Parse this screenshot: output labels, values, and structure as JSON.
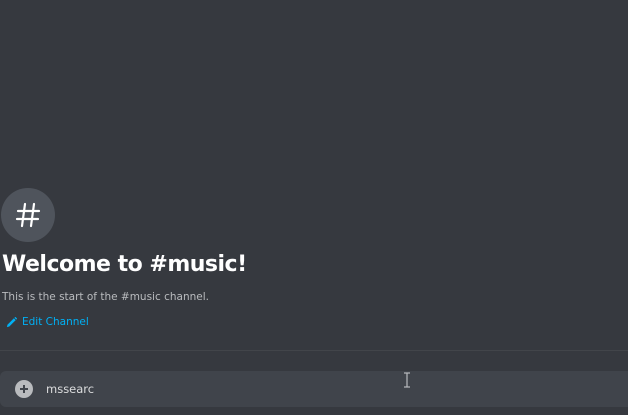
{
  "channel": {
    "welcome_title": "Welcome to #music!",
    "welcome_description": "This is the start of the #music channel.",
    "edit_label": "Edit Channel",
    "hash_icon": "hash-icon",
    "edit_icon": "pencil-icon"
  },
  "composer": {
    "value": "mssearc",
    "plus_icon": "plus-circle-icon"
  },
  "colors": {
    "background": "#36393f",
    "composer_background": "#40444b",
    "link": "#00b0f4",
    "title": "#ffffff"
  }
}
